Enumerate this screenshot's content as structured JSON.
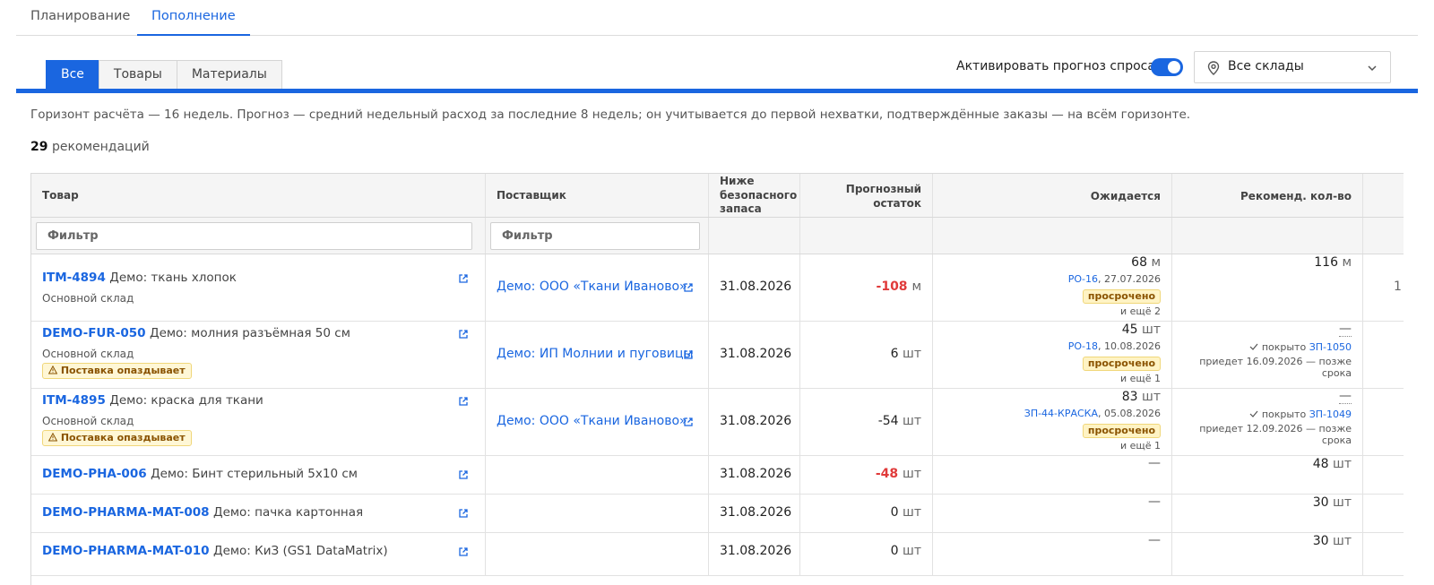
{
  "top_tabs": [
    {
      "label": "Планирование"
    },
    {
      "label": "Пополнение"
    }
  ],
  "sub_tabs": [
    {
      "label": "Все"
    },
    {
      "label": "Товары"
    },
    {
      "label": "Материалы"
    }
  ],
  "forecast": {
    "label": "Активировать прогноз спроса",
    "enabled": true
  },
  "warehouse": {
    "value": "Все склады"
  },
  "info_text": "Горизонт расчёта — 16 недель. Прогноз — средний недельный расход за последние 8 недель; он учитывается до первой нехватки, подтверждённые заказы — на всём горизонте.",
  "count": {
    "number": "29",
    "label": "рекомендаций"
  },
  "columns": {
    "product": "Товар",
    "supplier": "Поставщик",
    "below_safety": [
      "Ниже",
      "безопасного",
      "запаса"
    ],
    "forecast_stock": [
      "Прогнозный",
      "остаток"
    ],
    "expected": "Ожидается",
    "recommended": "Рекоменд. кол-во"
  },
  "filters": {
    "product_placeholder": "Фильтр",
    "supplier_placeholder": "Фильтр"
  },
  "rows": [
    {
      "code": "ITM-4894",
      "name": "Демо: ткань хлопок",
      "warehouse": "Основной склад",
      "warning": "",
      "supplier": "Демо: ООО «Ткани Иваново»",
      "date": "31.08.2026",
      "stock_value": "-108",
      "stock_unit": "м",
      "expected_value": "68",
      "expected_unit": "м",
      "expected_doc": "РО-16",
      "expected_date": ", 27.07.2026",
      "expected_status": "просрочено",
      "expected_more": "и ещё 2",
      "rec_value": "116",
      "rec_unit": "м",
      "rec_covered_label": "",
      "rec_covered_doc": "",
      "rec_note": "",
      "extra": "1"
    },
    {
      "code": "DEMO-FUR-050",
      "name": "Демо: молния разъёмная 50 см",
      "warehouse": "Основной склад",
      "warning": "Поставка опаздывает",
      "supplier": "Демо: ИП Молнии и пуговицы",
      "date": "31.08.2026",
      "stock_value": "6",
      "stock_unit": "шт",
      "expected_value": "45",
      "expected_unit": "шт",
      "expected_doc": "РО-18",
      "expected_date": ", 10.08.2026",
      "expected_status": "просрочено",
      "expected_more": "и ещё 1",
      "rec_value": "—",
      "rec_unit": "",
      "rec_covered_label": "покрыто",
      "rec_covered_doc": "ЗП-1050",
      "rec_note": "приедет 16.09.2026 — позже срока",
      "extra": ""
    },
    {
      "code": "ITM-4895",
      "name": "Демо: краска для ткани",
      "warehouse": "Основной склад",
      "warning": "Поставка опаздывает",
      "supplier": "Демо: ООО «Ткани Иваново»",
      "date": "31.08.2026",
      "stock_value": "-54",
      "stock_unit": "шт",
      "expected_value": "83",
      "expected_unit": "шт",
      "expected_doc": "ЗП-44-КРАСКА",
      "expected_date": ", 05.08.2026",
      "expected_status": "просрочено",
      "expected_more": "и ещё 1",
      "rec_value": "—",
      "rec_unit": "",
      "rec_covered_label": "покрыто",
      "rec_covered_doc": "ЗП-1049",
      "rec_note": "приедет 12.09.2026 — позже срока",
      "extra": ""
    },
    {
      "code": "DEMO-PHA-006",
      "name": "Демо: Бинт стерильный 5х10 см",
      "warehouse": "",
      "warning": "",
      "supplier": "",
      "date": "31.08.2026",
      "stock_value": "-48",
      "stock_unit": "шт",
      "expected_value": "—",
      "expected_unit": "",
      "expected_doc": "",
      "expected_date": "",
      "expected_status": "",
      "expected_more": "",
      "rec_value": "48",
      "rec_unit": "шт",
      "rec_covered_label": "",
      "rec_covered_doc": "",
      "rec_note": "",
      "extra": ""
    },
    {
      "code": "DEMO-PHARMA-MAT-008",
      "name": "Демо: пачка картонная",
      "warehouse": "",
      "warning": "",
      "supplier": "",
      "date": "31.08.2026",
      "stock_value": "0",
      "stock_unit": "шт",
      "expected_value": "—",
      "expected_unit": "",
      "expected_doc": "",
      "expected_date": "",
      "expected_status": "",
      "expected_more": "",
      "rec_value": "30",
      "rec_unit": "шт",
      "rec_covered_label": "",
      "rec_covered_doc": "",
      "rec_note": "",
      "extra": ""
    },
    {
      "code": "DEMO-PHARMA-MAT-010",
      "name": "Демо: КиЗ (GS1 DataMatrix)",
      "warehouse": "",
      "warning": "",
      "supplier": "",
      "date": "31.08.2026",
      "stock_value": "0",
      "stock_unit": "шт",
      "expected_value": "—",
      "expected_unit": "",
      "expected_doc": "",
      "expected_date": "",
      "expected_status": "",
      "expected_more": "",
      "rec_value": "30",
      "rec_unit": "шт",
      "rec_covered_label": "",
      "rec_covered_doc": "",
      "rec_note": "",
      "extra": ""
    }
  ],
  "icons": {
    "external_link": "external-link-icon",
    "warning": "warning-icon",
    "check": "check-icon",
    "location": "location-pin-icon",
    "dropdown": "chevron-down-icon"
  },
  "colors": {
    "accent": "#1a66e0",
    "negative": "#e03a3a",
    "warning_bg": "#fff7d6"
  }
}
